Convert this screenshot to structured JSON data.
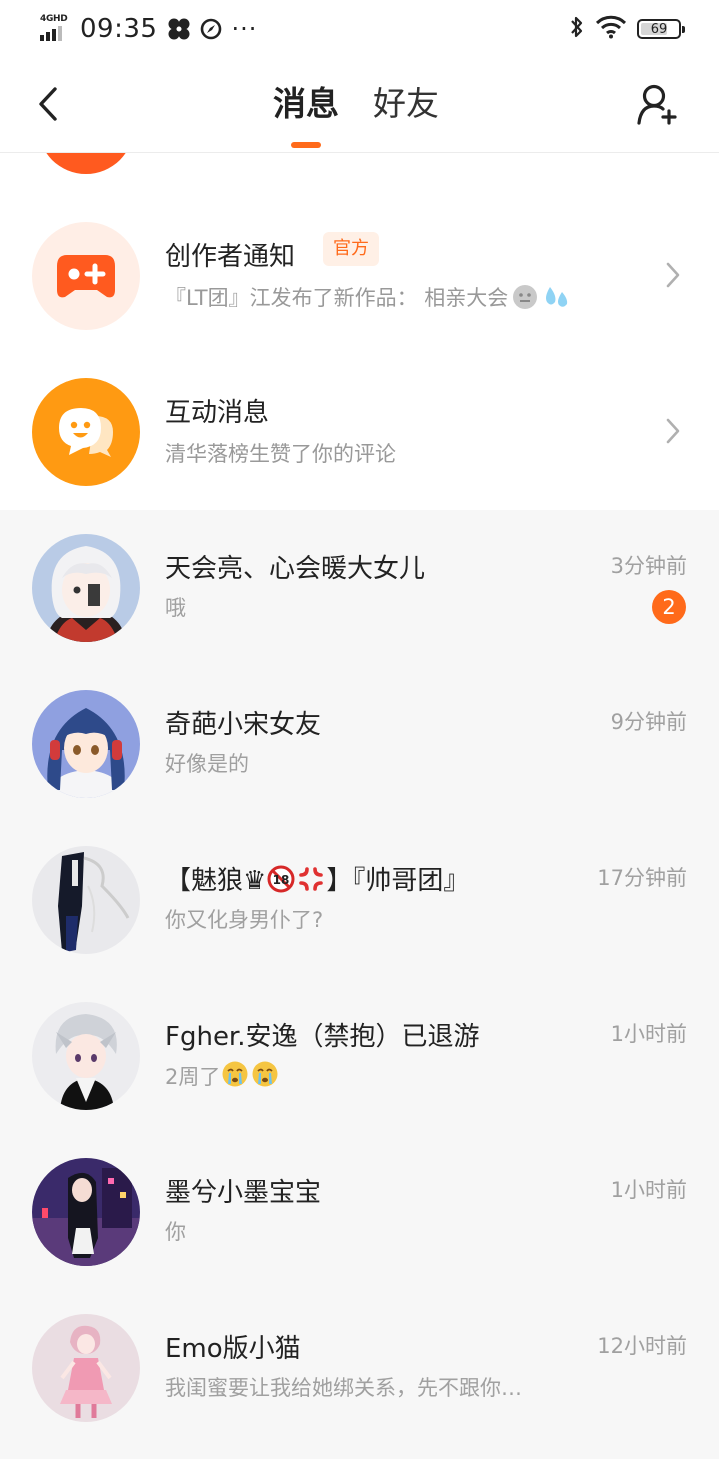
{
  "status_bar": {
    "network": "4GHD",
    "time": "09:35",
    "more": "···",
    "battery_level": "69"
  },
  "header": {
    "tabs": [
      {
        "label": "消息",
        "active": true
      },
      {
        "label": "好友",
        "active": false
      }
    ],
    "icons": {
      "back": "chevron-left-icon",
      "add_friend": "add-user-icon"
    },
    "accent_color": "#ff6a1a"
  },
  "system_rows": [
    {
      "title": "创作者通知",
      "badge": "官方",
      "subtitle": "『LT团』江发布了新作品：  相亲大会",
      "icon": "gamepad-icon",
      "color": "#ff5a1f"
    },
    {
      "title": "互动消息",
      "subtitle": "清华落榜生赞了你的评论",
      "icon": "chat-bubble-icon",
      "color": "#ff9a12"
    }
  ],
  "chats": [
    {
      "name": "天会亮、心会暖大女儿",
      "message": "哦",
      "time": "3分钟前",
      "unread": "2"
    },
    {
      "name": "奇葩小宋女友",
      "message": "好像是的",
      "time": "9分钟前",
      "unread": null
    },
    {
      "name_parts": [
        "【魅狼♛",
        "】『帅哥团』"
      ],
      "message": "你又化身男仆了?",
      "time": "17分钟前",
      "unread": null
    },
    {
      "name": "Fgher.安逸（禁抱）已退游",
      "message": "2周了",
      "time": "1小时前",
      "unread": null
    },
    {
      "name": "墨兮小墨宝宝",
      "message": "你",
      "time": "1小时前",
      "unread": null
    },
    {
      "name": "Emo版小猫",
      "message": "我闺蜜要让我给她绑关系，先不跟你…",
      "time": "12小时前",
      "unread": null
    }
  ]
}
